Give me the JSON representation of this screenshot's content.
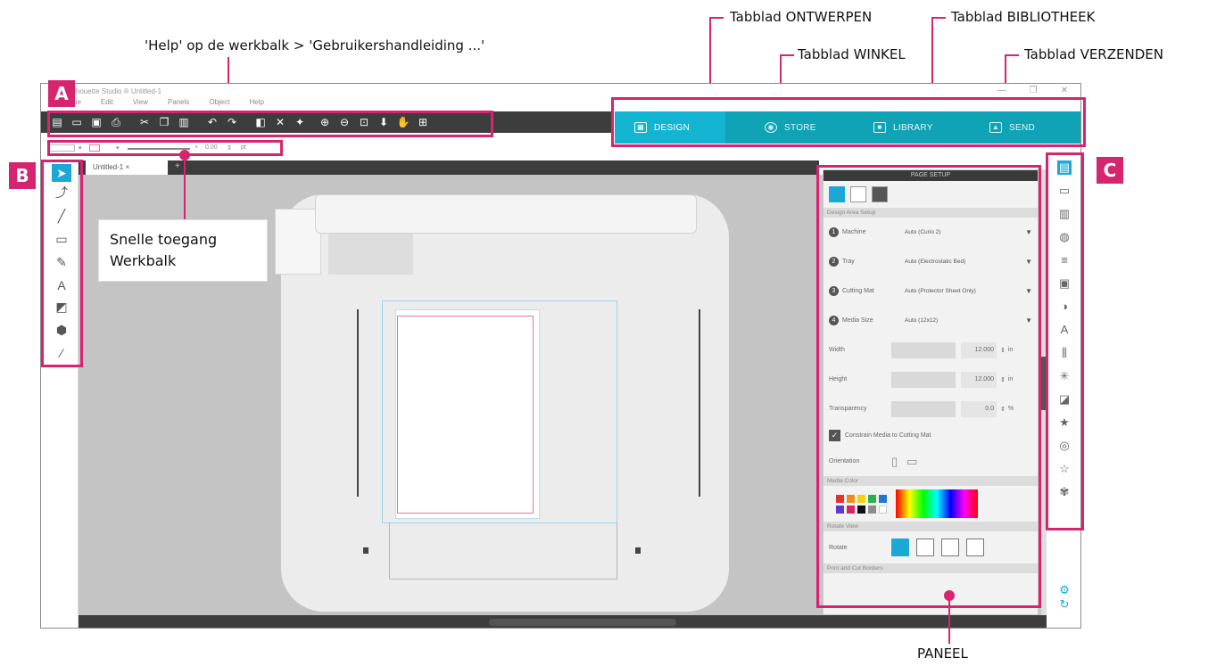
{
  "annotations": {
    "help_note": "'Help' op de werkbalk > 'Gebruikershandleiding ...'",
    "tab_design": "Tabblad ONTWERPEN",
    "tab_library": "Tabblad BIBLIOTHEEK",
    "tab_store": "Tabblad WINKEL",
    "tab_send": "Tabblad VERZENDEN",
    "quick_access_line1": "Snelle toegang",
    "quick_access_line2": "Werkbalk",
    "panel": "PANEEL",
    "badge_a": "A",
    "badge_b": "B",
    "badge_c": "C"
  },
  "app": {
    "title": "Silhouette Studio ® Untitled-1",
    "window_controls": [
      "—",
      "❐",
      "✕"
    ],
    "menu": [
      "File",
      "Edit",
      "View",
      "Panels",
      "Object",
      "Help"
    ],
    "tabs": [
      {
        "label": "DESIGN",
        "icon": "grid-icon",
        "active": true
      },
      {
        "label": "STORE",
        "icon": "store-icon",
        "active": false
      },
      {
        "label": "LIBRARY",
        "icon": "library-icon",
        "active": false
      },
      {
        "label": "SEND",
        "icon": "send-icon",
        "active": false
      }
    ],
    "quick_access": {
      "thickness": "0.00",
      "unit": "pt"
    },
    "document_tab": "Untitled-1",
    "colors": {
      "accent": "#12b4d2",
      "tabbar": "#0fa3b5",
      "toolbar": "#3d3d3d",
      "annotation": "#d6246f"
    }
  },
  "panel": {
    "title": "PAGE SETUP",
    "section_design": "Design Area Setup",
    "rows": [
      {
        "num": "1",
        "label": "Machine",
        "value": "Auto (Curio 2)"
      },
      {
        "num": "2",
        "label": "Tray",
        "value": "Auto (Electrostatic Bed)"
      },
      {
        "num": "3",
        "label": "Cutting Mat",
        "value": "Auto (Protector Sheet Only)"
      },
      {
        "num": "4",
        "label": "Media Size",
        "value": "Auto (12x12)"
      }
    ],
    "width_label": "Width",
    "width_value": "12.000",
    "width_unit": "in",
    "height_label": "Height",
    "height_value": "12.000",
    "height_unit": "in",
    "transparency_label": "Transparency",
    "transparency_value": "0.0",
    "transparency_unit": "%",
    "constrain_label": "Constrain Media to Cutting Mat",
    "orientation_label": "Orientation",
    "media_color_section": "Media Color",
    "rotate_view_section": "Rotate View",
    "rotate_label": "Rotate",
    "print_cut_section": "Print and Cut Borders"
  }
}
